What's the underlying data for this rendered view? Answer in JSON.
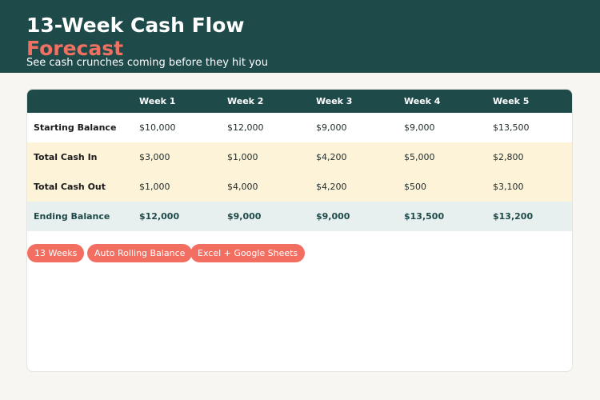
{
  "header": {
    "title_line1": "13-Week Cash Flow",
    "title_line2": "Forecast",
    "subtitle": "See cash crunches coming before they hit you"
  },
  "table": {
    "columns": [
      "",
      "Week 1",
      "Week 2",
      "Week 3",
      "Week 4",
      "Week 5"
    ],
    "rows": [
      {
        "label": "Starting Balance",
        "values": [
          "$10,000",
          "$12,000",
          "$9,000",
          "$9,000",
          "$13,500"
        ]
      },
      {
        "label": "Total Cash In",
        "values": [
          "$3,000",
          "$1,000",
          "$4,200",
          "$5,000",
          "$2,800"
        ]
      },
      {
        "label": "Total Cash Out",
        "values": [
          "$1,000",
          "$4,000",
          "$4,200",
          "$500",
          "$3,100"
        ]
      },
      {
        "label": "Ending Balance",
        "values": [
          "$12,000",
          "$9,000",
          "$9,000",
          "$13,500",
          "$13,200"
        ]
      }
    ]
  },
  "tags": [
    "13 Weeks",
    "Auto Rolling Balance",
    "Excel + Google Sheets"
  ],
  "colors": {
    "header_bg": "#1f4a4a",
    "accent": "#f26e60",
    "highlight_row": "#fdf3d9",
    "total_row": "#e8f0ef",
    "page_bg": "#f8f6f2"
  }
}
